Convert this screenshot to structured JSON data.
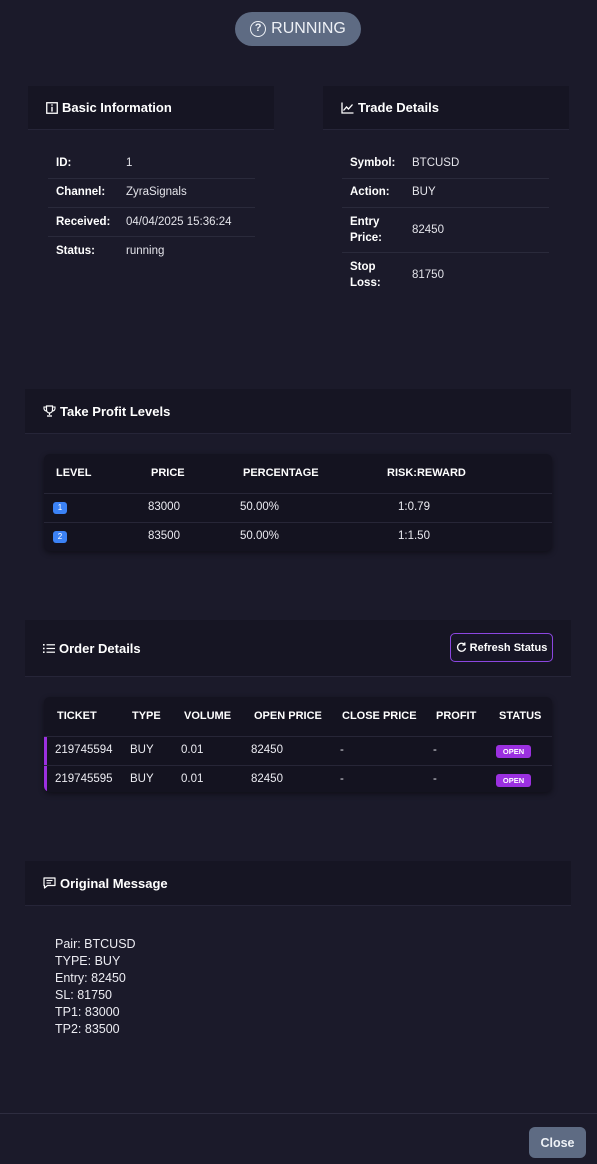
{
  "status_pill": {
    "label": "RUNNING"
  },
  "basic_info": {
    "title": "Basic Information",
    "rows": [
      {
        "key": "ID:",
        "value": "1"
      },
      {
        "key": "Channel:",
        "value": "ZyraSignals"
      },
      {
        "key": "Received:",
        "value": "04/04/2025 15:36:24"
      },
      {
        "key": "Status:",
        "value": "running"
      }
    ]
  },
  "trade_details": {
    "title": "Trade Details",
    "rows": [
      {
        "key": "Symbol:",
        "value": "BTCUSD"
      },
      {
        "key": "Action:",
        "value": "BUY"
      },
      {
        "key_line1": "Entry",
        "key_line2": "Price:",
        "value": "82450"
      },
      {
        "key_line1": "Stop",
        "key_line2": "Loss:",
        "value": "81750"
      }
    ]
  },
  "take_profit": {
    "title": "Take Profit Levels",
    "headers": [
      "LEVEL",
      "PRICE",
      "PERCENTAGE",
      "RISK:REWARD"
    ],
    "rows": [
      {
        "level": "1",
        "price": "83000",
        "percentage": "50.00%",
        "risk_reward": "1:0.79"
      },
      {
        "level": "2",
        "price": "83500",
        "percentage": "50.00%",
        "risk_reward": "1:1.50"
      }
    ]
  },
  "order_details": {
    "title": "Order Details",
    "refresh_label": "Refresh Status",
    "headers": [
      "TICKET",
      "TYPE",
      "VOLUME",
      "OPEN PRICE",
      "CLOSE PRICE",
      "PROFIT",
      "STATUS"
    ],
    "rows": [
      {
        "ticket": "219745594",
        "type": "BUY",
        "volume": "0.01",
        "open_price": "82450",
        "close_price": "-",
        "profit": "-",
        "status": "OPEN"
      },
      {
        "ticket": "219745595",
        "type": "BUY",
        "volume": "0.01",
        "open_price": "82450",
        "close_price": "-",
        "profit": "-",
        "status": "OPEN"
      }
    ]
  },
  "original_message": {
    "title": "Original Message",
    "lines": [
      "Pair: BTCUSD",
      "TYPE: BUY",
      "Entry: 82450",
      "SL: 81750",
      "TP1: 83000",
      "TP2: 83500"
    ]
  },
  "footer": {
    "close_label": "Close"
  },
  "colors": {
    "background": "#1b1a2a",
    "accent_purple": "#9b30e0",
    "level_blue": "#3b82f6",
    "pill_gray": "#5e6b83"
  }
}
